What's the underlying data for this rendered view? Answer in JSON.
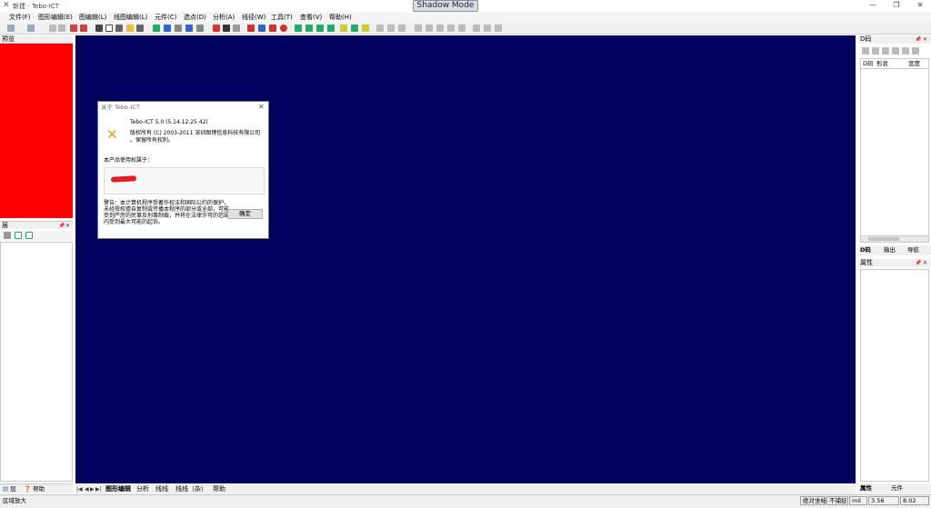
{
  "window": {
    "title": "新建 - Tebo-ICT",
    "shadow_mode_label": "Shadow Mode"
  },
  "menu": [
    "文件(F)",
    "图形编辑(E)",
    "图编辑(L)",
    "线图编辑(L)",
    "元件(C)",
    "选点(D)",
    "分析(A)",
    "线径(W)",
    "工具(T)",
    "查看(V)",
    "帮助(H)"
  ],
  "left_panels": {
    "preview_title": "预览",
    "layer_title": "层",
    "bottom_tab_layer": "层",
    "bottom_tab_help": "帮助",
    "colors": {
      "preview_fill": "#ff0000"
    }
  },
  "sheet_tabs": {
    "nav": [
      "|◀",
      "◀",
      "▶",
      "▶|"
    ],
    "tabs": [
      "图形编辑",
      "分析",
      "线线",
      "线线（杂）",
      "帮助"
    ]
  },
  "right_panels": {
    "dcode_title": "D码",
    "dcode_columns": [
      "D码",
      "形状",
      "宽度"
    ],
    "mid_tabs": [
      "D码",
      "输出",
      "导航"
    ],
    "properties_title": "属性",
    "bottom_tabs": [
      "属性",
      "元件"
    ]
  },
  "canvas": {
    "background": "#00005e"
  },
  "status": {
    "left_text": "区域放大",
    "mode_label": "绝对坐标",
    "snap_label": "不捕捉",
    "unit": "mil",
    "x": "3.56",
    "y": "8.02"
  },
  "about_dialog": {
    "title": "关于 Tebo-ICT",
    "version": "Tebo-ICT 5.0 (5.14.12.25.42)",
    "copyright": "版权所有 (C) 2003-2011 深圳图博信息科技有限公司 。保留所有权利。",
    "licensed_to_label": "本产品使用权属于：",
    "warning": "警告：本计算机程序受著作权法和国际公约的保护，未经授权擅自复制或传播本程序的部分或全部，可能受到严厉的民事及刑事制裁，并将在法律许可的范围内受到最大可能的起诉。",
    "ok_label": "确定"
  }
}
